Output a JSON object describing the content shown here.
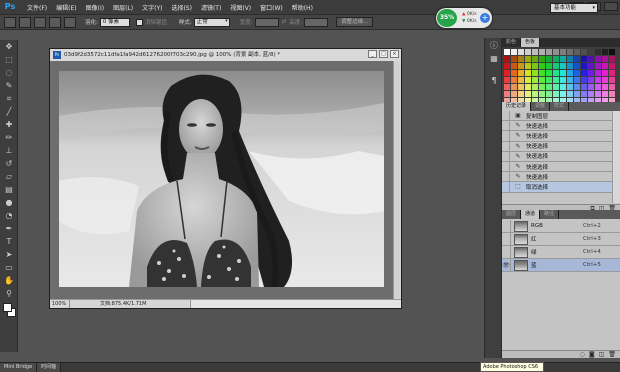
{
  "app": {
    "logo": "Ps",
    "menus": [
      "文件(F)",
      "编辑(E)",
      "图像(I)",
      "图层(L)",
      "文字(Y)",
      "选择(S)",
      "滤镜(T)",
      "视图(V)",
      "窗口(W)",
      "帮助(H)"
    ],
    "workspace": "基本功能"
  },
  "options": {
    "feather_label": "羽化:",
    "feather_value": "0 像素",
    "antialias_label": "消除锯齿",
    "style_label": "样式:",
    "style_value": "正常",
    "width_label": "宽度:",
    "height_label": "高度:",
    "refine_button": "调整边缘..."
  },
  "netwidget": {
    "percent": "35%",
    "up": "0K/s",
    "down": "0K/s",
    "plus": "+"
  },
  "document": {
    "title": "03d9f2d3572c11dfa1fa942d61276200f703c290.jpg @ 100% (背景 副本, 蓝/8) *",
    "zoom": "100%",
    "size": "文档:875.4K/1.71M"
  },
  "panels": {
    "color_tabs": [
      "颜色",
      "色板"
    ],
    "history_tabs": [
      "历史记录",
      "调整",
      "样式"
    ],
    "history_items": [
      "复制图层",
      "快速选择",
      "快速选择",
      "快速选择",
      "快速选择",
      "快速选择",
      "快速选择",
      "取消选择"
    ],
    "channel_tabs": [
      "图层",
      "通道",
      "路径"
    ],
    "channels": [
      {
        "name": "RGB",
        "key": "Ctrl+2"
      },
      {
        "name": "红",
        "key": "Ctrl+3"
      },
      {
        "name": "绿",
        "key": "Ctrl+4"
      },
      {
        "name": "蓝",
        "key": "Ctrl+5"
      }
    ]
  },
  "bottom": {
    "tabs": [
      "Mini Bridge",
      "时间轴"
    ],
    "tooltip": "Adobe Photoshop CS6"
  },
  "colors": {
    "selection": "#b6c5e0",
    "ps_blue": "#2fa3f5"
  }
}
